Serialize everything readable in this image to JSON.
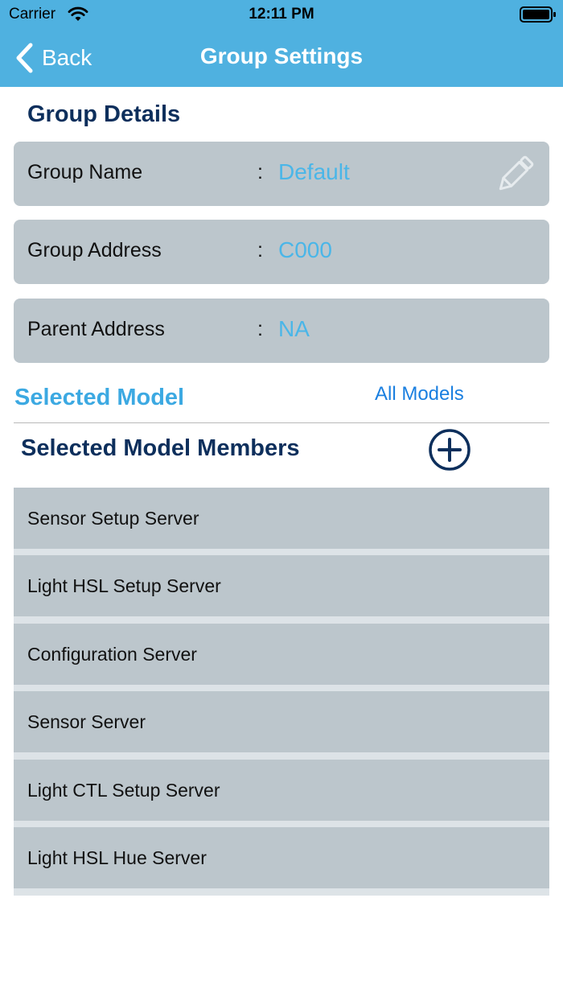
{
  "status_bar": {
    "carrier": "Carrier",
    "time": "12:11 PM"
  },
  "nav": {
    "back_label": "Back",
    "title": "Group Settings"
  },
  "group_details": {
    "title": "Group Details",
    "rows": [
      {
        "label": "Group Name",
        "colon": ":",
        "value": "Default"
      },
      {
        "label": "Group Address",
        "colon": ":",
        "value": "C000"
      },
      {
        "label": "Parent Address",
        "colon": ":",
        "value": "NA"
      }
    ]
  },
  "selected_model": {
    "label": "Selected Model",
    "all_models_link": "All Models"
  },
  "members": {
    "title": "Selected Model Members",
    "items": [
      "Sensor Setup Server",
      "Light HSL Setup Server",
      "Configuration Server",
      "Sensor Server",
      "Light CTL Setup Server",
      "Light HSL Hue Server"
    ]
  },
  "colors": {
    "nav_bar": "#4fb1e0",
    "heading": "#0d2f5c",
    "value_text": "#4ab6e8",
    "link": "#1a7fe0",
    "row_background": "#bcc6cc"
  },
  "icons": [
    "wifi-icon",
    "battery-icon",
    "back-chevron-icon",
    "pencil-edit-icon",
    "add-circle-icon"
  ]
}
